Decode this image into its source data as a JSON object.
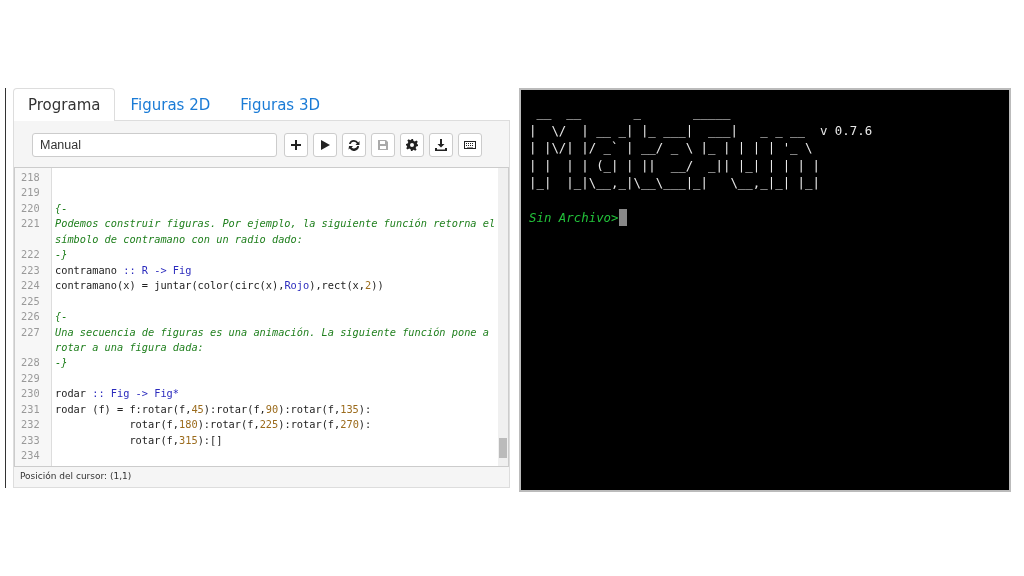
{
  "tabs": [
    {
      "label": "Programa",
      "selected": true
    },
    {
      "label": "Figuras 2D",
      "selected": false
    },
    {
      "label": "Figuras 3D",
      "selected": false
    }
  ],
  "toolbar": {
    "file_field": {
      "value": "Manual"
    },
    "buttons": [
      {
        "kind": "new",
        "disabled": false
      },
      {
        "kind": "run",
        "disabled": false
      },
      {
        "kind": "reload",
        "disabled": false
      },
      {
        "kind": "save",
        "disabled": true
      },
      {
        "kind": "settings",
        "disabled": false
      },
      {
        "kind": "download",
        "disabled": false
      },
      {
        "kind": "keyboard",
        "disabled": false
      }
    ]
  },
  "editor": {
    "lines": [
      {
        "number": "218"
      },
      {
        "number": "219"
      },
      {
        "number": "220",
        "tokens": [
          {
            "kind": "comment",
            "text": "{-"
          }
        ]
      },
      {
        "number": "221",
        "tokens": [
          {
            "kind": "comment",
            "text": "Podemos construir figuras. Por ejemplo, la siguiente función retorna el símbolo de contramano con un radio dado:"
          }
        ]
      },
      {
        "number": "222",
        "tokens": [
          {
            "kind": "comment",
            "text": "-}"
          }
        ]
      },
      {
        "number": "223",
        "tokens": [
          {
            "kind": "plain",
            "text": "contramano "
          },
          {
            "kind": "type",
            "text": ":: R -> Fig"
          }
        ]
      },
      {
        "number": "224",
        "tokens": [
          {
            "kind": "plain",
            "text": "contramano(x) = juntar(color(circ(x),"
          },
          {
            "kind": "type",
            "text": "Rojo"
          },
          {
            "kind": "plain",
            "text": "),rect(x,"
          },
          {
            "kind": "number",
            "text": "2"
          },
          {
            "kind": "plain",
            "text": "))"
          }
        ]
      },
      {
        "number": "225"
      },
      {
        "number": "226",
        "tokens": [
          {
            "kind": "comment",
            "text": "{-"
          }
        ]
      },
      {
        "number": "227",
        "tokens": [
          {
            "kind": "comment",
            "text": "Una secuencia de figuras es una animación. La siguiente función pone a rotar a una figura dada:"
          }
        ]
      },
      {
        "number": "228",
        "tokens": [
          {
            "kind": "comment",
            "text": "-}"
          }
        ]
      },
      {
        "number": "229"
      },
      {
        "number": "230",
        "tokens": [
          {
            "kind": "plain",
            "text": "rodar "
          },
          {
            "kind": "type",
            "text": ":: Fig -> Fig*"
          }
        ]
      },
      {
        "number": "231",
        "tokens": [
          {
            "kind": "plain",
            "text": "rodar (f) = f:rotar(f,"
          },
          {
            "kind": "number",
            "text": "45"
          },
          {
            "kind": "plain",
            "text": "):rotar(f,"
          },
          {
            "kind": "number",
            "text": "90"
          },
          {
            "kind": "plain",
            "text": "):rotar(f,"
          },
          {
            "kind": "number",
            "text": "135"
          },
          {
            "kind": "plain",
            "text": "):"
          }
        ]
      },
      {
        "number": "232",
        "tokens": [
          {
            "kind": "plain",
            "text": "            rotar(f,"
          },
          {
            "kind": "number",
            "text": "180"
          },
          {
            "kind": "plain",
            "text": "):rotar(f,"
          },
          {
            "kind": "number",
            "text": "225"
          },
          {
            "kind": "plain",
            "text": "):rotar(f,"
          },
          {
            "kind": "number",
            "text": "270"
          },
          {
            "kind": "plain",
            "text": "):"
          }
        ]
      },
      {
        "number": "233",
        "tokens": [
          {
            "kind": "plain",
            "text": "            rotar(f,"
          },
          {
            "kind": "number",
            "text": "315"
          },
          {
            "kind": "plain",
            "text": "):[]"
          }
        ]
      },
      {
        "number": "234"
      }
    ]
  },
  "status_bar": "Posición del cursor: (1,1)",
  "terminal": {
    "banner": [
      " __  __       _       _____",
      "|  \\/  | __ _| |_ ___|  ___|   _ _ __",
      "| |\\/| |/ _` | __/ _ \\ |_ | | | | '_ \\",
      "| |  | | (_| | ||  __/  _|| |_| | | | |",
      "|_|  |_|\\__,_|\\__\\___|_|   \\__,_|_| |_|"
    ],
    "version": "v 0.7.6",
    "prompt": "Sin Archivo>"
  }
}
